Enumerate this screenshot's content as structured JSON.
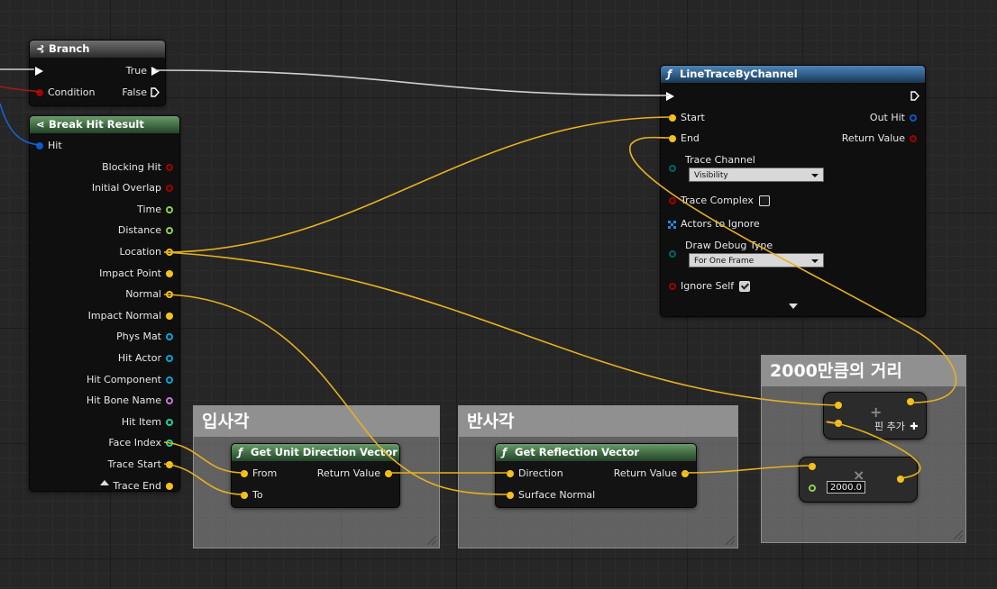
{
  "colors": {
    "exec": "#ffffff",
    "bool": "#a30000",
    "struct": "#0e57c8",
    "float": "#8fd04e",
    "vector": "#f5c21b",
    "object": "#0aa2d8",
    "name": "#c07ad6",
    "integer": "#1fd39a",
    "enum": "#00665e",
    "wire": "#e6b020"
  },
  "branch": {
    "title": "Branch",
    "icon": "branch-icon",
    "true_label": "True",
    "false_label": "False",
    "condition_label": "Condition"
  },
  "break_hit": {
    "title": "Break Hit Result",
    "icon": "break-struct-icon",
    "input_label": "Hit",
    "outputs": [
      {
        "label": "Blocking Hit",
        "type": "bool"
      },
      {
        "label": "Initial Overlap",
        "type": "bool"
      },
      {
        "label": "Time",
        "type": "float"
      },
      {
        "label": "Distance",
        "type": "float"
      },
      {
        "label": "Location",
        "type": "vector"
      },
      {
        "label": "Impact Point",
        "type": "vector",
        "connected": true
      },
      {
        "label": "Normal",
        "type": "vector"
      },
      {
        "label": "Impact Normal",
        "type": "vector",
        "connected": true
      },
      {
        "label": "Phys Mat",
        "type": "object"
      },
      {
        "label": "Hit Actor",
        "type": "object"
      },
      {
        "label": "Hit Component",
        "type": "object"
      },
      {
        "label": "Hit Bone Name",
        "type": "name"
      },
      {
        "label": "Hit Item",
        "type": "integer"
      },
      {
        "label": "Face Index",
        "type": "integer"
      },
      {
        "label": "Trace Start",
        "type": "vector",
        "connected": true
      },
      {
        "label": "Trace End",
        "type": "vector",
        "connected": true
      }
    ]
  },
  "line_trace": {
    "title": "LineTraceByChannel",
    "icon": "function-icon",
    "start_label": "Start",
    "end_label": "End",
    "out_hit_label": "Out Hit",
    "return_value_label": "Return Value",
    "trace_channel_label": "Trace Channel",
    "trace_channel_value": "Visibility",
    "trace_complex_label": "Trace Complex",
    "trace_complex_checked": false,
    "actors_to_ignore_label": "Actors to Ignore",
    "draw_debug_type_label": "Draw Debug Type",
    "draw_debug_type_value": "For One Frame",
    "ignore_self_label": "Ignore Self",
    "ignore_self_checked": true
  },
  "comments": {
    "incidence": "입사각",
    "reflection": "반사각",
    "distance": "2000만큼의 거리"
  },
  "get_unit_dir": {
    "title": "Get Unit Direction Vector",
    "icon": "function-icon",
    "from_label": "From",
    "to_label": "To",
    "return_label": "Return Value"
  },
  "get_reflection": {
    "title": "Get Reflection Vector",
    "icon": "function-icon",
    "direction_label": "Direction",
    "surface_normal_label": "Surface Normal",
    "return_label": "Return Value"
  },
  "add_node": {
    "symbol": "+",
    "add_pin_label": "핀 추가"
  },
  "multiply_node": {
    "symbol": "×",
    "value": "2000.0"
  }
}
